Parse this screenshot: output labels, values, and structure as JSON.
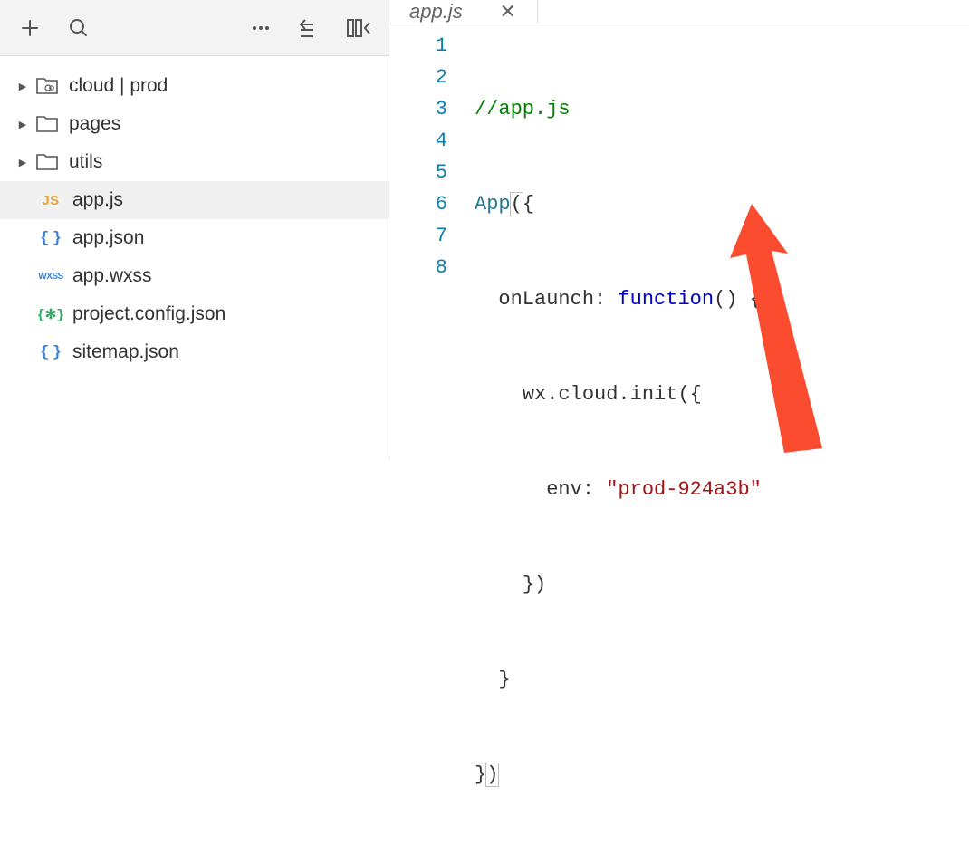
{
  "sidebar": {
    "folders": [
      {
        "label": "cloud | prod",
        "type": "cloud"
      },
      {
        "label": "pages",
        "type": "folder"
      },
      {
        "label": "utils",
        "type": "folder"
      }
    ],
    "files": [
      {
        "label": "app.js",
        "icon": "js",
        "selected": true
      },
      {
        "label": "app.json",
        "icon": "json",
        "selected": false
      },
      {
        "label": "app.wxss",
        "icon": "wxss",
        "selected": false
      },
      {
        "label": "project.config.json",
        "icon": "config",
        "selected": false
      },
      {
        "label": "sitemap.json",
        "icon": "json",
        "selected": false
      }
    ]
  },
  "editor": {
    "tab_label": "app.js",
    "code": {
      "line1_comment": "//app.js",
      "line2_app": "App",
      "line2_rest": "({",
      "line3_indent": "  ",
      "line3_text": "onLaunch: ",
      "line3_keyword": "function",
      "line3_rest": "() {",
      "line4_indent": "    ",
      "line4_text": "wx.cloud.init({",
      "line5_indent": "      ",
      "line5_text": "env: ",
      "line5_string": "\"prod-924a3b\"",
      "line6_indent": "    ",
      "line6_text": "})",
      "line7_indent": "  ",
      "line7_text": "}",
      "line8_a": "}",
      "line8_b": ")"
    }
  }
}
